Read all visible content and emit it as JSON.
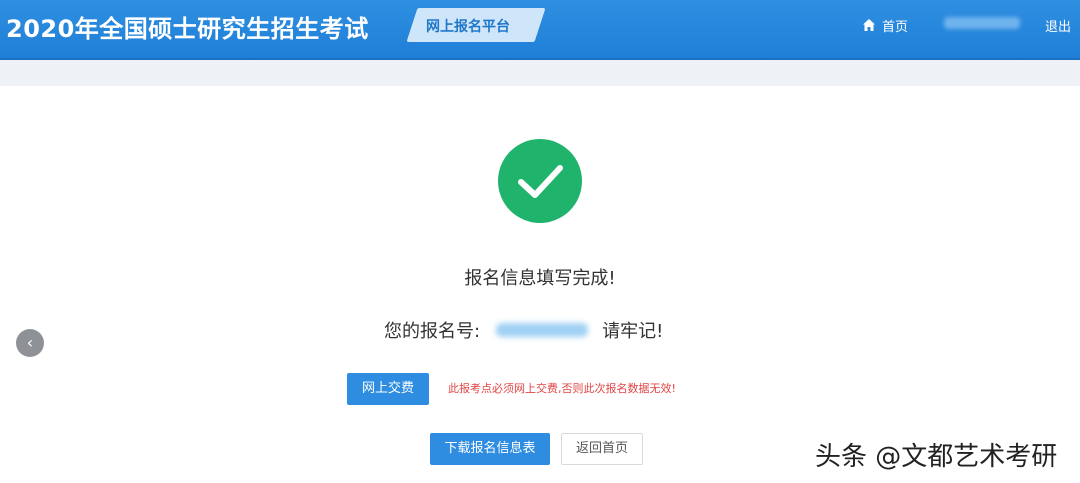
{
  "header": {
    "site_title": "2020年全国硕士研究生招生考试",
    "platform_label": "网上报名平台",
    "home_label": "首页",
    "logout_label": "退出"
  },
  "main": {
    "success_message": "报名信息填写完成!",
    "reg_prefix": "您的报名号:",
    "reg_suffix": "请牢记!",
    "pay_button_label": "网上交费",
    "pay_warning": "此报考点必须网上交费,否则此次报名数据无效!",
    "download_button_label": "下载报名信息表",
    "home_button_label": "返回首页"
  },
  "carousel": {
    "prev_glyph": "‹"
  },
  "watermark": {
    "text": "头条 @文都艺术考研"
  },
  "icons": {
    "success": "check-circle-icon",
    "home": "home-icon"
  },
  "colors": {
    "header_blue": "#2f8fe0",
    "success_green": "#1fb36b",
    "primary_button": "#2e8de0",
    "warning_red": "#e04545"
  }
}
